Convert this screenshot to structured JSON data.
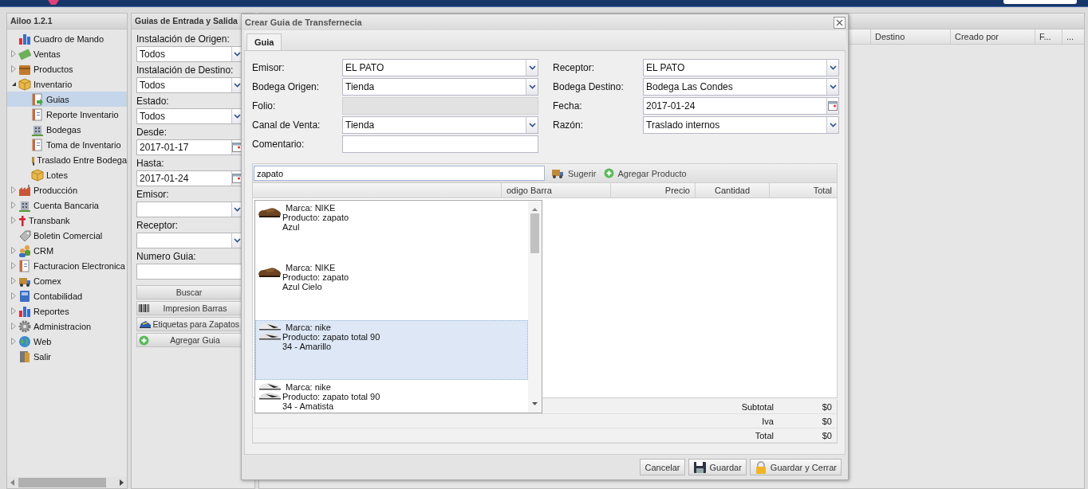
{
  "app": {
    "title": "Ailoo 1.2.1"
  },
  "nav": [
    {
      "label": "Cuadro de Mando",
      "kind": "leaf",
      "selected": false
    },
    {
      "label": "Ventas",
      "kind": "folder",
      "expanded": false,
      "selected": false
    },
    {
      "label": "Productos",
      "kind": "folder",
      "expanded": false,
      "selected": false
    },
    {
      "label": "Inventario",
      "kind": "folder",
      "expanded": true,
      "selected": false,
      "children": [
        {
          "label": "Guias",
          "selected": true
        },
        {
          "label": "Reporte Inventario",
          "selected": false
        },
        {
          "label": "Bodegas",
          "selected": false
        },
        {
          "label": "Toma de Inventario",
          "selected": false
        },
        {
          "label": "Traslado Entre Bodega",
          "selected": false
        },
        {
          "label": "Lotes",
          "selected": false
        }
      ]
    },
    {
      "label": "Producción",
      "kind": "folder",
      "expanded": false,
      "selected": false
    },
    {
      "label": "Cuenta Bancaria",
      "kind": "folder",
      "expanded": false,
      "selected": false
    },
    {
      "label": "Transbank",
      "kind": "folder",
      "expanded": false,
      "selected": false
    },
    {
      "label": "Boletin Comercial",
      "kind": "leaf",
      "selected": false
    },
    {
      "label": "CRM",
      "kind": "folder",
      "expanded": false,
      "selected": false
    },
    {
      "label": "Facturacion Electronica",
      "kind": "folder",
      "expanded": false,
      "selected": false
    },
    {
      "label": "Comex",
      "kind": "folder",
      "expanded": false,
      "selected": false
    },
    {
      "label": "Contabilidad",
      "kind": "folder",
      "expanded": false,
      "selected": false
    },
    {
      "label": "Reportes",
      "kind": "folder",
      "expanded": false,
      "selected": false
    },
    {
      "label": "Administracion",
      "kind": "folder",
      "expanded": false,
      "selected": false
    },
    {
      "label": "Web",
      "kind": "folder",
      "expanded": false,
      "selected": false
    },
    {
      "label": "Salir",
      "kind": "leaf",
      "selected": false
    }
  ],
  "filters": {
    "title": "Guias de Entrada y Salida",
    "fields": [
      {
        "label": "Instalación de Origen:",
        "kind": "select",
        "value": "Todos"
      },
      {
        "label": "Instalación de Destino:",
        "kind": "select",
        "value": "Todos"
      },
      {
        "label": "Estado:",
        "kind": "select",
        "value": "Todos"
      },
      {
        "label": "Desde:",
        "kind": "date",
        "value": "2017-01-17"
      },
      {
        "label": "Hasta:",
        "kind": "date",
        "value": "2017-01-24"
      },
      {
        "label": "Emisor:",
        "kind": "select"
      },
      {
        "label": "Receptor:",
        "kind": "select"
      },
      {
        "label": "Numero Guia:",
        "kind": "text"
      }
    ],
    "buttons": [
      {
        "label": "Buscar",
        "kind": "plain"
      },
      {
        "label": "Impresion Barras",
        "kind": "barcode"
      },
      {
        "label": "Etiquetas para Zapatos",
        "kind": "shoe"
      },
      {
        "label": "Agregar Guia",
        "kind": "add"
      }
    ]
  },
  "grid": {
    "columns": [
      "Destino",
      "Creado por",
      "F...",
      "..."
    ]
  },
  "dialog": {
    "title": "Crear Guia de Transfernecia",
    "tabs": [
      {
        "label": "Guia",
        "selected": true
      }
    ],
    "left_fields": [
      {
        "label": "Emisor:",
        "kind": "select",
        "value": "EL PATO",
        "disabled": false
      },
      {
        "label": "Bodega Origen:",
        "kind": "select",
        "value": "Tienda",
        "disabled": false
      },
      {
        "label": "Folio:",
        "kind": "text",
        "disabled": true
      },
      {
        "label": "Canal de Venta:",
        "kind": "select",
        "value": "Tienda",
        "disabled": false
      },
      {
        "label": "Comentario:",
        "kind": "text",
        "disabled": false
      }
    ],
    "right_fields": [
      {
        "label": "Receptor:",
        "kind": "select",
        "value": "EL PATO",
        "disabled": false
      },
      {
        "label": "Bodega Destino:",
        "kind": "select",
        "value": "Bodega Las Condes",
        "disabled": false
      },
      {
        "label": "Fecha:",
        "kind": "date",
        "value": "2017-01-24",
        "disabled": false
      },
      {
        "label": "Razón:",
        "kind": "select",
        "value": "Traslado internos",
        "disabled": false
      }
    ],
    "product_search": {
      "value": "zapato"
    },
    "toolbar": [
      {
        "label": "Sugerir",
        "kind": "suggest"
      },
      {
        "label": "Agregar Producto",
        "kind": "add"
      }
    ],
    "columns": [
      "odigo Barra",
      "Precio",
      "Cantidad",
      "Total"
    ],
    "suggestions": [
      {
        "kind": "dress",
        "lines": [
          "Marca: NIKE",
          "Producto: zapato",
          "Azul"
        ],
        "selected": false
      },
      {
        "kind": "dress",
        "lines": [
          "Marca: NIKE",
          "Producto: zapato",
          "Azul Cielo"
        ],
        "selected": false
      },
      {
        "kind": "cleat",
        "lines": [
          "Marca: nike",
          "Producto: zapato total 90",
          "34 - Amarillo"
        ],
        "selected": true
      },
      {
        "kind": "cleat",
        "lines": [
          "Marca: nike",
          "Producto: zapato total 90",
          "34 - Amatista"
        ],
        "selected": false
      }
    ],
    "totals": [
      {
        "label": "Subtotal",
        "value": "$0"
      },
      {
        "label": "Iva",
        "value": "$0"
      },
      {
        "label": "Total",
        "value": "$0"
      }
    ],
    "buttons": [
      {
        "label": "Cancelar",
        "kind": "plain"
      },
      {
        "label": "Guardar",
        "kind": "save"
      },
      {
        "label": "Guardar y Cerrar",
        "kind": "lock"
      }
    ]
  }
}
